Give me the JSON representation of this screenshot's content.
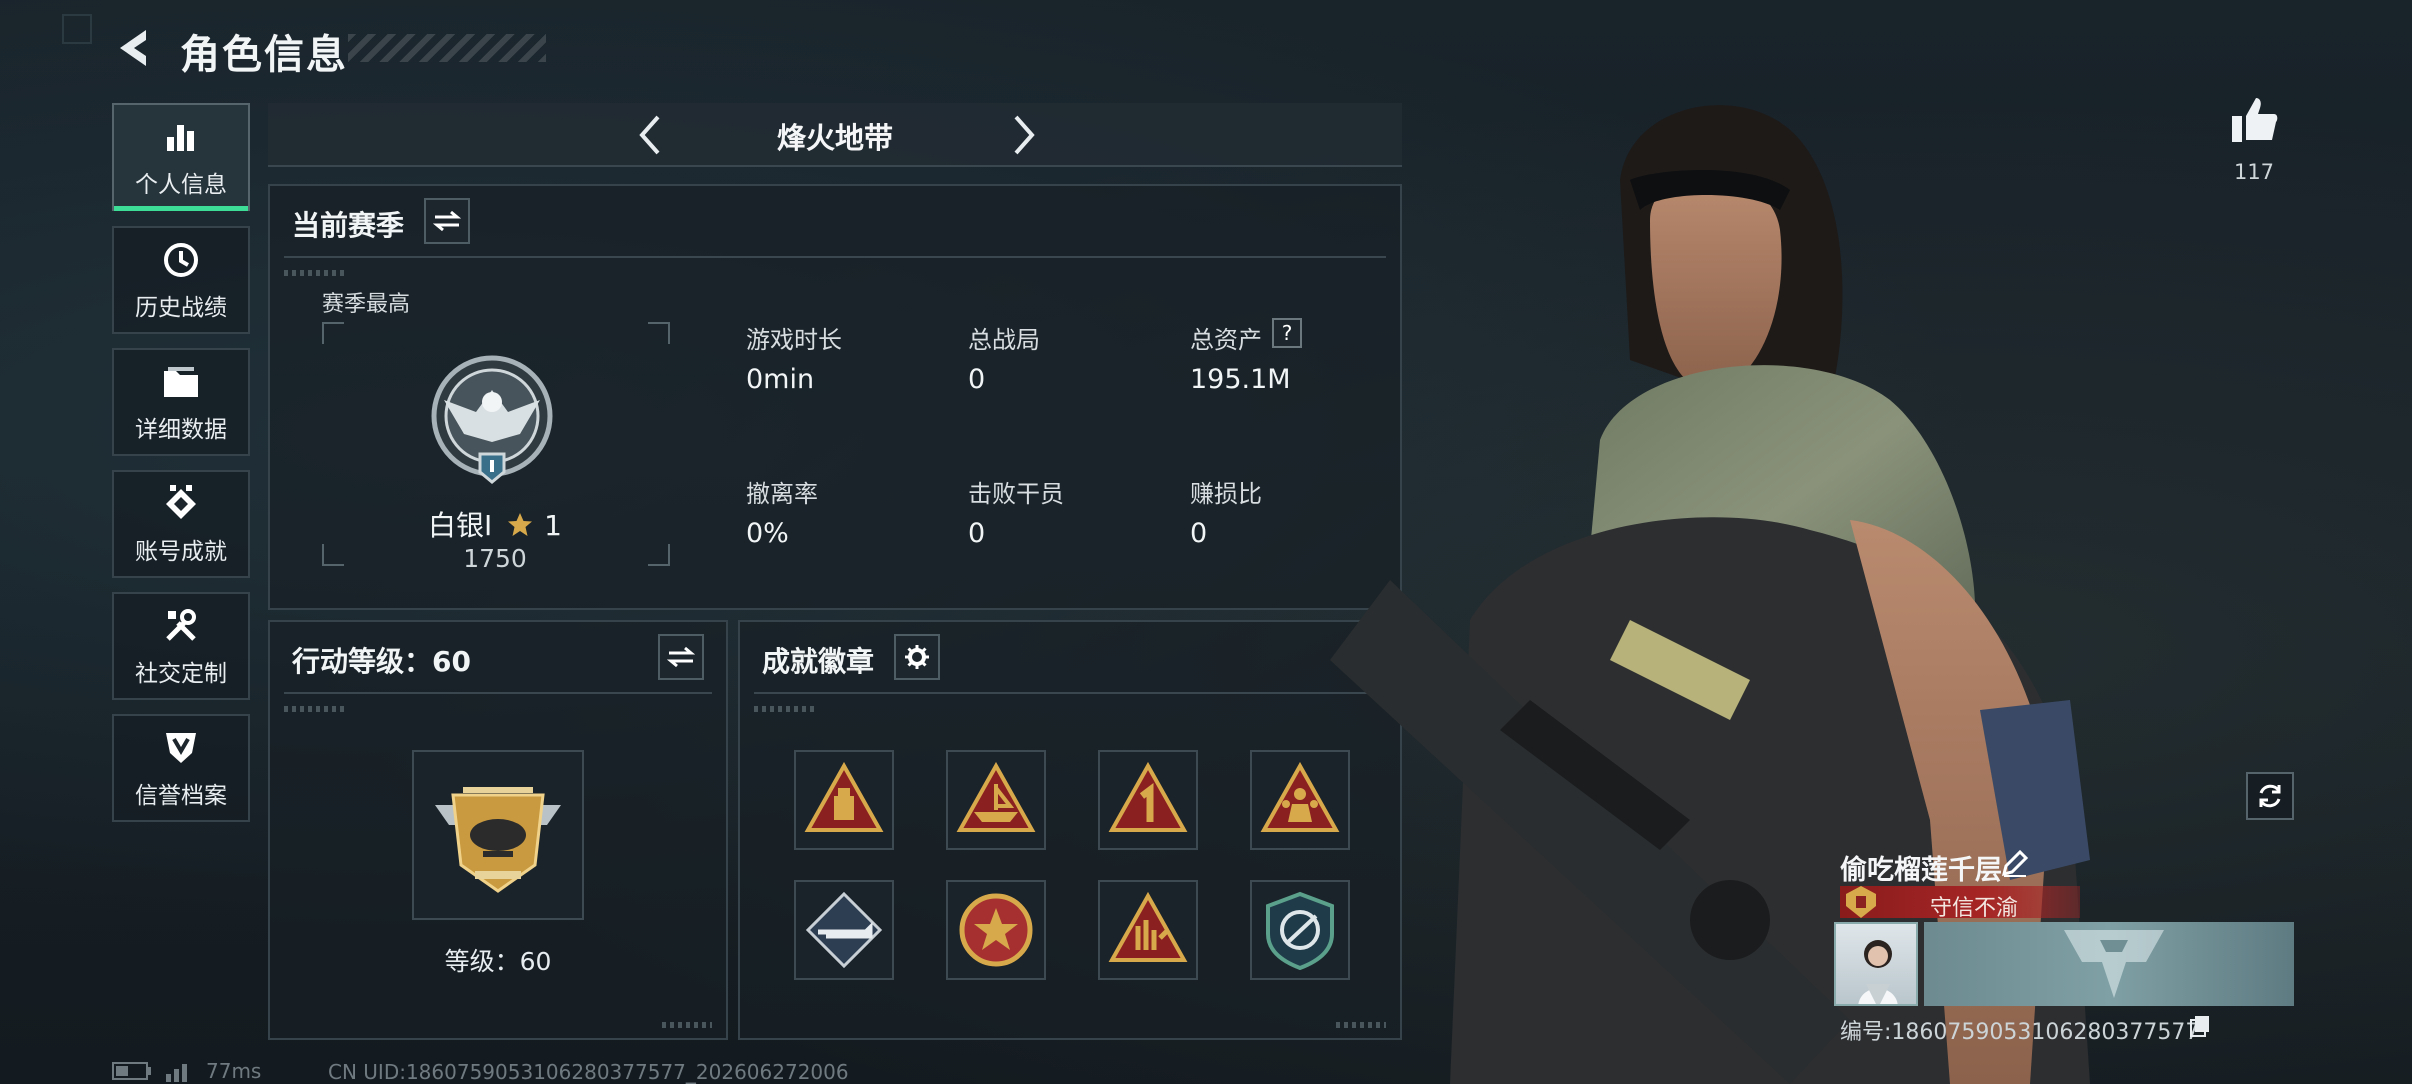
{
  "header": {
    "title": "角色信息"
  },
  "sidebar": {
    "items": [
      {
        "label": "个人信息",
        "icon": "bar-chart-icon",
        "active": true
      },
      {
        "label": "历史战绩",
        "icon": "history-icon"
      },
      {
        "label": "详细数据",
        "icon": "folder-icon"
      },
      {
        "label": "账号成就",
        "icon": "achievement-icon"
      },
      {
        "label": "社交定制",
        "icon": "tools-icon"
      },
      {
        "label": "信誉档案",
        "icon": "credit-shield-icon"
      }
    ]
  },
  "mode_selector": {
    "title": "烽火地带"
  },
  "season": {
    "title": "当前赛季",
    "best_label": "赛季最高",
    "rank_name": "白银I",
    "rank_stars": "1",
    "rank_points": "1750",
    "stats": [
      {
        "label": "游戏时长",
        "value": "0min"
      },
      {
        "label": "总战局",
        "value": "0"
      },
      {
        "label": "总资产",
        "value": "195.1M",
        "help": "?"
      },
      {
        "label": "撤离率",
        "value": "0%"
      },
      {
        "label": "击败干员",
        "value": "0"
      },
      {
        "label": "赚损比",
        "value": "0"
      }
    ]
  },
  "action_level": {
    "title": "行动等级：60",
    "level_text": "等级：60"
  },
  "achievements": {
    "title": "成就徽章",
    "badges": [
      "supply-badge-icon",
      "ship-badge-icon",
      "number-one-badge-icon",
      "squad-badge-icon",
      "rifle-badge-icon",
      "star-seal-badge-icon",
      "hand-sign-badge-icon",
      "operator-badge-icon"
    ]
  },
  "likes": {
    "count": "117"
  },
  "player": {
    "name": "偷吃榴莲千层",
    "reputation": "守信不渝",
    "id_line": "编号:1860759053106280377577"
  },
  "status": {
    "ping": "77ms",
    "uid": "CN UID:1860759053106280377577_202606272006"
  },
  "colors": {
    "accent": "#3ddc97",
    "reputation": "#a62525",
    "gold": "#d8a94a"
  }
}
